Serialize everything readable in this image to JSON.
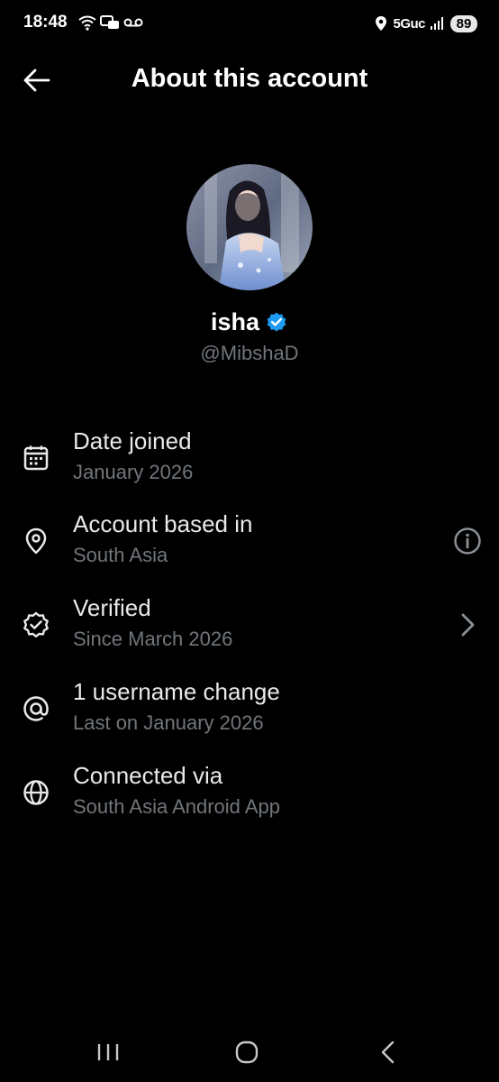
{
  "status_bar": {
    "time": "18:48",
    "network": "5Guc",
    "battery": "89",
    "icons": [
      "wifi-icon",
      "chat-icon",
      "voicemail-icon",
      "location-icon",
      "signal-icon"
    ]
  },
  "header": {
    "title": "About this account",
    "back_icon": "arrow-left-icon"
  },
  "profile": {
    "display_name": "isha",
    "handle": "@MibshaD",
    "verified": true,
    "verified_color": "#1d9bf0"
  },
  "rows": [
    {
      "icon": "calendar-icon",
      "title": "Date joined",
      "subtitle": "January 2026",
      "action": null
    },
    {
      "icon": "location-pin-icon",
      "title": "Account based in",
      "subtitle": "South Asia",
      "action": "info-icon"
    },
    {
      "icon": "verified-badge-icon",
      "title": "Verified",
      "subtitle": "Since March 2026",
      "action": "chevron-right-icon"
    },
    {
      "icon": "at-sign-icon",
      "title": "1 username change",
      "subtitle": "Last on January 2026",
      "action": null
    },
    {
      "icon": "globe-icon",
      "title": "Connected via",
      "subtitle": "South Asia Android App",
      "action": null
    }
  ],
  "nav_bar": {
    "buttons": [
      "recents-icon",
      "home-icon",
      "back-icon"
    ]
  },
  "colors": {
    "background": "#000000",
    "primary_text": "#e7e9ea",
    "secondary_text": "#71767b",
    "accent": "#1d9bf0"
  }
}
